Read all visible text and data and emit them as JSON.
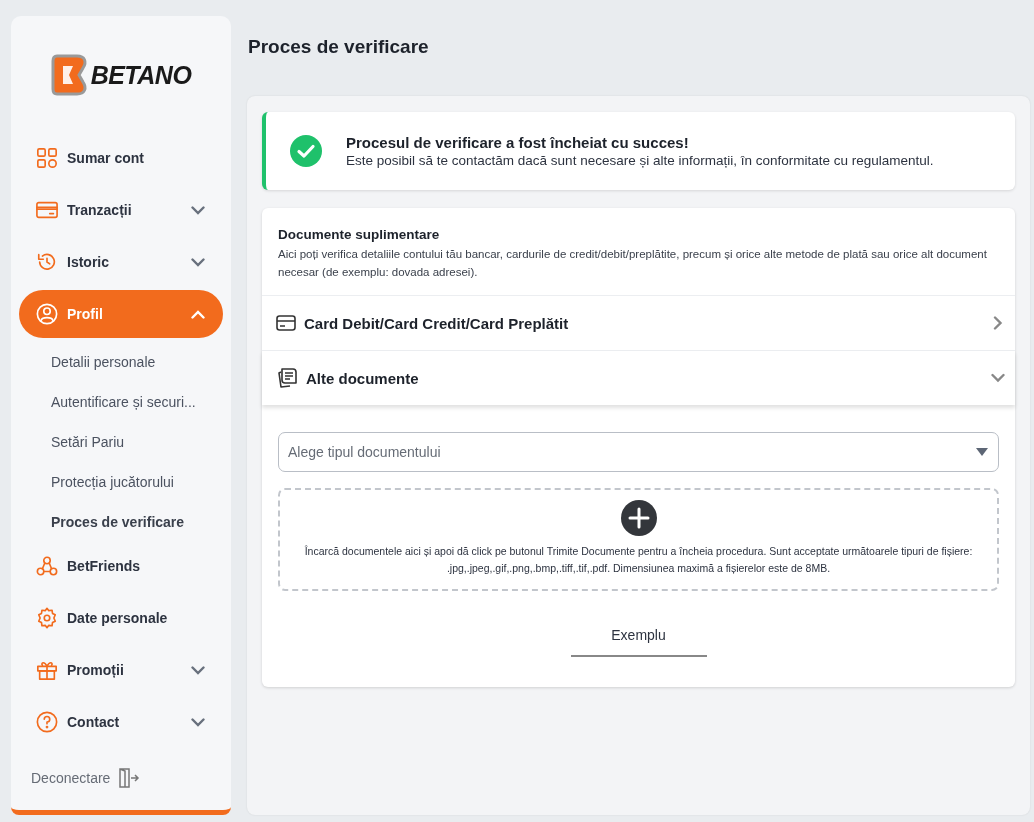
{
  "logo": {
    "text": "BETANO"
  },
  "nav": [
    {
      "kind": "grid",
      "label": "Sumar cont",
      "selected": false
    },
    {
      "kind": "card",
      "label": "Tranzacții",
      "selected": false,
      "expanded": false
    },
    {
      "kind": "history",
      "label": "Istoric",
      "selected": false,
      "expanded": false
    },
    {
      "kind": "user",
      "label": "Profil",
      "selected": true,
      "expanded": true,
      "children": [
        {
          "label": "Detalii personale",
          "selected": false
        },
        {
          "label": "Autentificare și securi...",
          "selected": false
        },
        {
          "label": "Setări Pariu",
          "selected": false
        },
        {
          "label": "Protecția jucătorului",
          "selected": false
        },
        {
          "label": "Proces de verificare",
          "selected": true
        }
      ]
    },
    {
      "kind": "friends",
      "label": "BetFriends",
      "selected": false
    },
    {
      "kind": "gear",
      "label": "Date personale",
      "selected": false
    },
    {
      "kind": "gift",
      "label": "Promoții",
      "selected": false,
      "expanded": false
    },
    {
      "kind": "help",
      "label": "Contact",
      "selected": false,
      "expanded": false
    }
  ],
  "logout": {
    "label": "Deconectare"
  },
  "page": {
    "title": "Proces de verificare"
  },
  "alert": {
    "title": "Procesul de verificare a fost încheiat cu succes!",
    "text": "Este posibil să te contactăm dacă sunt necesare și alte informații, în conformitate cu regulamentul."
  },
  "documents": {
    "title": "Documente suplimentare",
    "description": "Aici poți verifica detaliile contului tău bancar, cardurile de credit/debit/preplătite, precum și orice alte metode de plată sau orice alt document necesar (de exemplu: dovada adresei).",
    "sections": [
      {
        "kind": "card",
        "label": "Card Debit/Card Credit/Card Preplătit",
        "expanded": false
      },
      {
        "kind": "docs",
        "label": "Alte documente",
        "expanded": true
      }
    ]
  },
  "select": {
    "placeholder": "Alege tipul documentului"
  },
  "upload": {
    "text": "Încarcă documentele aici și apoi dă click pe butonul Trimite Documente pentru a încheia procedura. Sunt acceptate următoarele tipuri de fișiere: .jpg,.jpeg,.gif,.png,.bmp,.tiff,.tif,.pdf. Dimensiunea maximă a fișierelor este de 8MB."
  },
  "example_button": {
    "label": "Exemplu"
  }
}
